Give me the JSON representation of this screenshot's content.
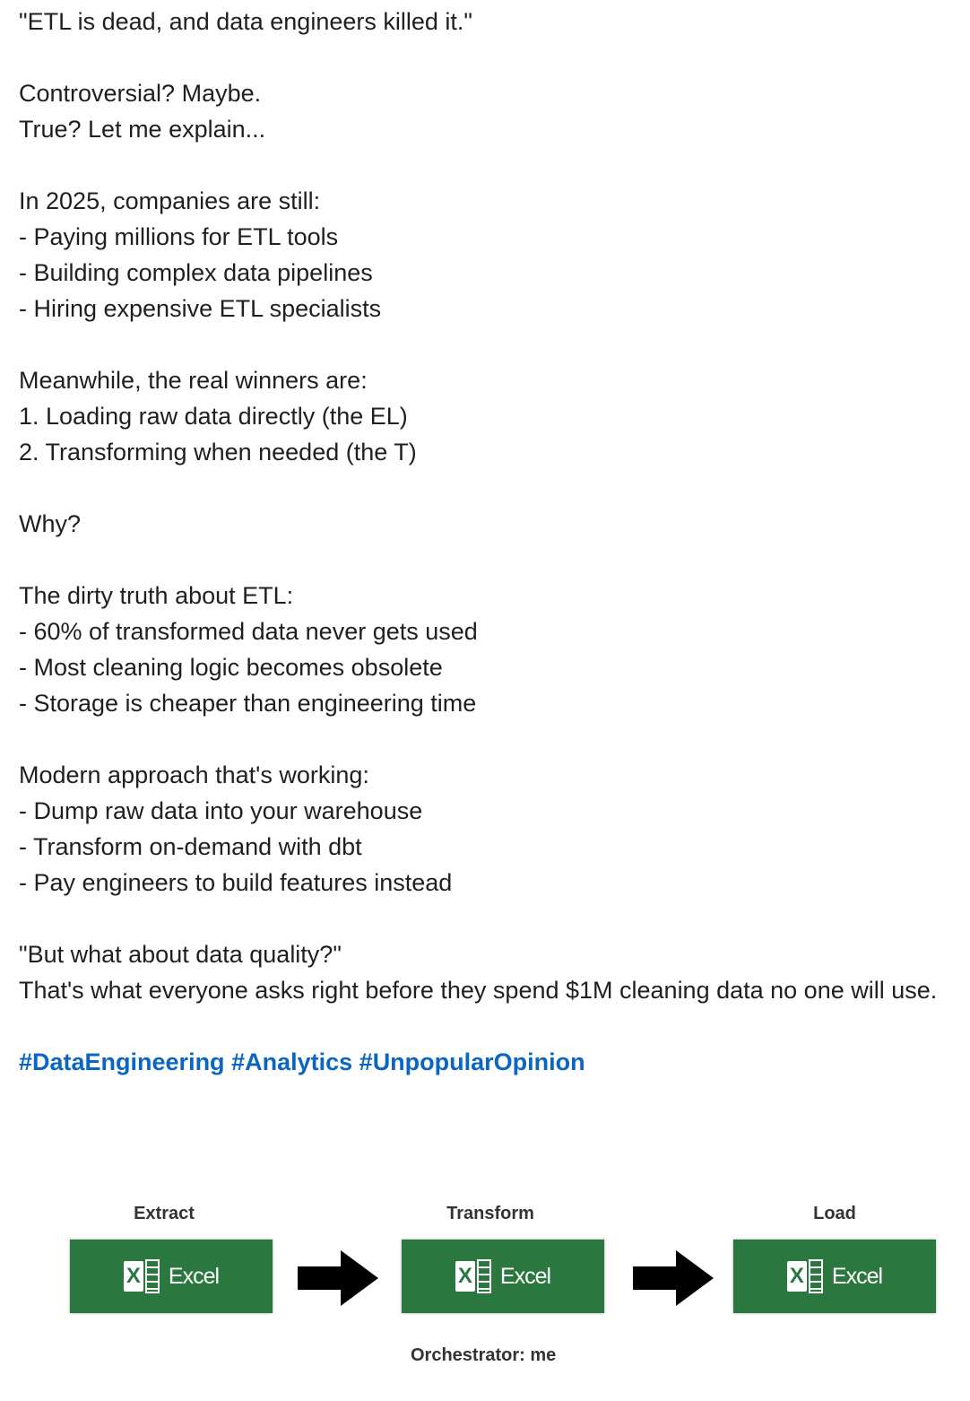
{
  "post": {
    "lines": [
      "\"ETL is dead, and data engineers killed it.\"",
      "",
      "Controversial? Maybe.",
      "True? Let me explain...",
      "",
      "In 2025, companies are still:",
      "- Paying millions for ETL tools",
      "- Building complex data pipelines",
      "- Hiring expensive ETL specialists",
      "",
      "Meanwhile, the real winners are:",
      "1. Loading raw data directly (the EL)",
      "2. Transforming when needed (the T)",
      "",
      "Why?",
      "",
      "The dirty truth about ETL:",
      "- 60% of transformed data never gets used",
      "- Most cleaning logic becomes obsolete",
      "- Storage is cheaper than engineering time",
      "",
      "Modern approach that's working:",
      "- Dump raw data into your warehouse",
      "- Transform on-demand with dbt",
      "- Pay engineers to build features instead",
      "",
      "\"But what about data quality?\"",
      "That's what everyone asks right before they spend $1M cleaning data no one will use.",
      ""
    ],
    "hashtags": [
      "#DataEngineering",
      "#Analytics",
      "#UnpopularOpinion"
    ],
    "hashtag_color": "#0a66c2"
  },
  "figure": {
    "stages": [
      {
        "label": "Extract",
        "app": "Excel"
      },
      {
        "label": "Transform",
        "app": "Excel"
      },
      {
        "label": "Load",
        "app": "Excel"
      }
    ],
    "caption": "Orchestrator: me",
    "tile_color": "#2b7740"
  }
}
